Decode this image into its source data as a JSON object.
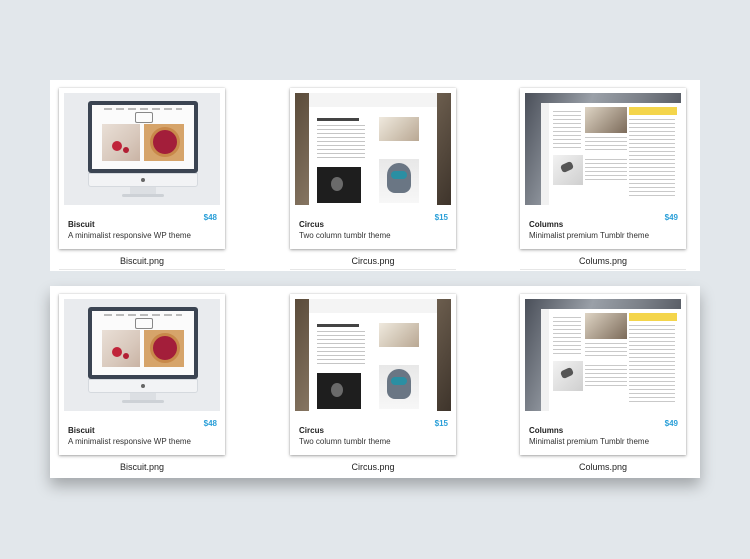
{
  "rows": [
    {
      "cards": [
        {
          "title": "Biscuit",
          "desc": "A minimalist responsive WP theme",
          "price": "$48",
          "file": "Biscuit.png"
        },
        {
          "title": "Circus",
          "desc": "Two column tumblr theme",
          "price": "$15",
          "file": "Circus.png"
        },
        {
          "title": "Columns",
          "desc": "Minimalist premium Tumblr theme",
          "price": "$49",
          "file": "Colums.png"
        }
      ]
    },
    {
      "cards": [
        {
          "title": "Biscuit",
          "desc": "A minimalist responsive WP theme",
          "price": "$48",
          "file": "Biscuit.png"
        },
        {
          "title": "Circus",
          "desc": "Two column tumblr theme",
          "price": "$15",
          "file": "Circus.png"
        },
        {
          "title": "Columns",
          "desc": "Minimalist premium Tumblr theme",
          "price": "$49",
          "file": "Colums.png"
        }
      ]
    }
  ],
  "colors": {
    "price": "#2a9fd8",
    "background": "#e2e7eb"
  }
}
